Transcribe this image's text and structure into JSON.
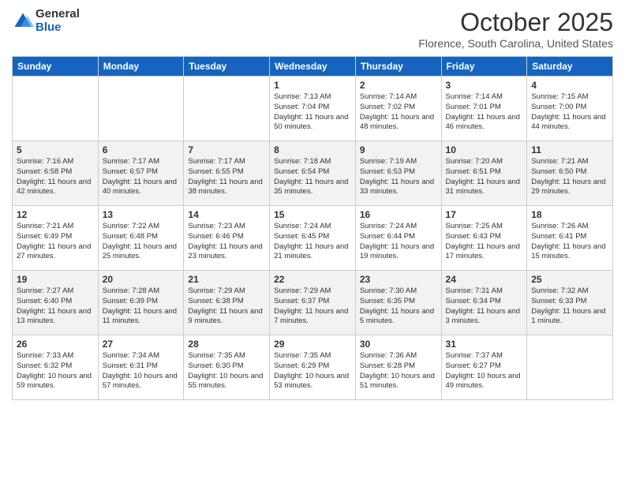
{
  "logo": {
    "general": "General",
    "blue": "Blue"
  },
  "title": "October 2025",
  "location": "Florence, South Carolina, United States",
  "days_header": [
    "Sunday",
    "Monday",
    "Tuesday",
    "Wednesday",
    "Thursday",
    "Friday",
    "Saturday"
  ],
  "weeks": [
    [
      {
        "day": "",
        "info": ""
      },
      {
        "day": "",
        "info": ""
      },
      {
        "day": "",
        "info": ""
      },
      {
        "day": "1",
        "info": "Sunrise: 7:13 AM\nSunset: 7:04 PM\nDaylight: 11 hours\nand 50 minutes."
      },
      {
        "day": "2",
        "info": "Sunrise: 7:14 AM\nSunset: 7:02 PM\nDaylight: 11 hours\nand 48 minutes."
      },
      {
        "day": "3",
        "info": "Sunrise: 7:14 AM\nSunset: 7:01 PM\nDaylight: 11 hours\nand 46 minutes."
      },
      {
        "day": "4",
        "info": "Sunrise: 7:15 AM\nSunset: 7:00 PM\nDaylight: 11 hours\nand 44 minutes."
      }
    ],
    [
      {
        "day": "5",
        "info": "Sunrise: 7:16 AM\nSunset: 6:58 PM\nDaylight: 11 hours\nand 42 minutes."
      },
      {
        "day": "6",
        "info": "Sunrise: 7:17 AM\nSunset: 6:57 PM\nDaylight: 11 hours\nand 40 minutes."
      },
      {
        "day": "7",
        "info": "Sunrise: 7:17 AM\nSunset: 6:55 PM\nDaylight: 11 hours\nand 38 minutes."
      },
      {
        "day": "8",
        "info": "Sunrise: 7:18 AM\nSunset: 6:54 PM\nDaylight: 11 hours\nand 35 minutes."
      },
      {
        "day": "9",
        "info": "Sunrise: 7:19 AM\nSunset: 6:53 PM\nDaylight: 11 hours\nand 33 minutes."
      },
      {
        "day": "10",
        "info": "Sunrise: 7:20 AM\nSunset: 6:51 PM\nDaylight: 11 hours\nand 31 minutes."
      },
      {
        "day": "11",
        "info": "Sunrise: 7:21 AM\nSunset: 6:50 PM\nDaylight: 11 hours\nand 29 minutes."
      }
    ],
    [
      {
        "day": "12",
        "info": "Sunrise: 7:21 AM\nSunset: 6:49 PM\nDaylight: 11 hours\nand 27 minutes."
      },
      {
        "day": "13",
        "info": "Sunrise: 7:22 AM\nSunset: 6:48 PM\nDaylight: 11 hours\nand 25 minutes."
      },
      {
        "day": "14",
        "info": "Sunrise: 7:23 AM\nSunset: 6:46 PM\nDaylight: 11 hours\nand 23 minutes."
      },
      {
        "day": "15",
        "info": "Sunrise: 7:24 AM\nSunset: 6:45 PM\nDaylight: 11 hours\nand 21 minutes."
      },
      {
        "day": "16",
        "info": "Sunrise: 7:24 AM\nSunset: 6:44 PM\nDaylight: 11 hours\nand 19 minutes."
      },
      {
        "day": "17",
        "info": "Sunrise: 7:25 AM\nSunset: 6:43 PM\nDaylight: 11 hours\nand 17 minutes."
      },
      {
        "day": "18",
        "info": "Sunrise: 7:26 AM\nSunset: 6:41 PM\nDaylight: 11 hours\nand 15 minutes."
      }
    ],
    [
      {
        "day": "19",
        "info": "Sunrise: 7:27 AM\nSunset: 6:40 PM\nDaylight: 11 hours\nand 13 minutes."
      },
      {
        "day": "20",
        "info": "Sunrise: 7:28 AM\nSunset: 6:39 PM\nDaylight: 11 hours\nand 11 minutes."
      },
      {
        "day": "21",
        "info": "Sunrise: 7:29 AM\nSunset: 6:38 PM\nDaylight: 11 hours\nand 9 minutes."
      },
      {
        "day": "22",
        "info": "Sunrise: 7:29 AM\nSunset: 6:37 PM\nDaylight: 11 hours\nand 7 minutes."
      },
      {
        "day": "23",
        "info": "Sunrise: 7:30 AM\nSunset: 6:35 PM\nDaylight: 11 hours\nand 5 minutes."
      },
      {
        "day": "24",
        "info": "Sunrise: 7:31 AM\nSunset: 6:34 PM\nDaylight: 11 hours\nand 3 minutes."
      },
      {
        "day": "25",
        "info": "Sunrise: 7:32 AM\nSunset: 6:33 PM\nDaylight: 11 hours\nand 1 minute."
      }
    ],
    [
      {
        "day": "26",
        "info": "Sunrise: 7:33 AM\nSunset: 6:32 PM\nDaylight: 10 hours\nand 59 minutes."
      },
      {
        "day": "27",
        "info": "Sunrise: 7:34 AM\nSunset: 6:31 PM\nDaylight: 10 hours\nand 57 minutes."
      },
      {
        "day": "28",
        "info": "Sunrise: 7:35 AM\nSunset: 6:30 PM\nDaylight: 10 hours\nand 55 minutes."
      },
      {
        "day": "29",
        "info": "Sunrise: 7:35 AM\nSunset: 6:29 PM\nDaylight: 10 hours\nand 53 minutes."
      },
      {
        "day": "30",
        "info": "Sunrise: 7:36 AM\nSunset: 6:28 PM\nDaylight: 10 hours\nand 51 minutes."
      },
      {
        "day": "31",
        "info": "Sunrise: 7:37 AM\nSunset: 6:27 PM\nDaylight: 10 hours\nand 49 minutes."
      },
      {
        "day": "",
        "info": ""
      }
    ]
  ]
}
